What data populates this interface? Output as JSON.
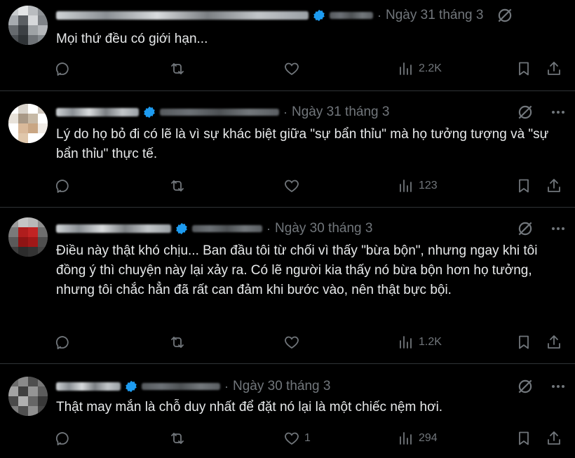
{
  "tweets": [
    {
      "date": "Ngày 31 tháng 3",
      "text": "Mọi thứ đều có giới hạn...",
      "likes": "",
      "views": "2.2K"
    },
    {
      "date": "Ngày 31 tháng 3",
      "text": "Lý do họ bỏ đi có lẽ là vì sự khác biệt giữa \"sự bẩn thỉu\" mà họ tưởng tượng và \"sự bẩn thỉu\" thực tế.",
      "likes": "",
      "views": "123"
    },
    {
      "date": "Ngày 30 tháng 3",
      "text": "Điều này thật khó chịu... Ban đầu tôi từ chối vì thấy \"bừa bộn\", nhưng ngay khi tôi đồng ý thì chuyện này lại xảy ra. Có lẽ người kia thấy nó bừa bộn hơn họ tưởng, nhưng tôi chắc hẳn đã rất can đảm khi bước vào, nên thật bực bội.",
      "likes": "",
      "views": "1.2K"
    },
    {
      "date": "Ngày 30 tháng 3",
      "text": "Thật may mắn là chỗ duy nhất để đặt nó lại là một chiếc nệm hơi.",
      "likes": "1",
      "views": "294"
    }
  ],
  "separator": "·",
  "colors": {
    "background": "#000000",
    "text": "#e7e9ea",
    "muted": "#71767b",
    "verified": "#1d9bf0",
    "border": "#2f3336"
  },
  "icons": [
    "verified-badge-icon",
    "grok-icon",
    "more-icon",
    "reply-icon",
    "retweet-icon",
    "like-icon",
    "views-icon",
    "bookmark-icon",
    "share-icon"
  ]
}
